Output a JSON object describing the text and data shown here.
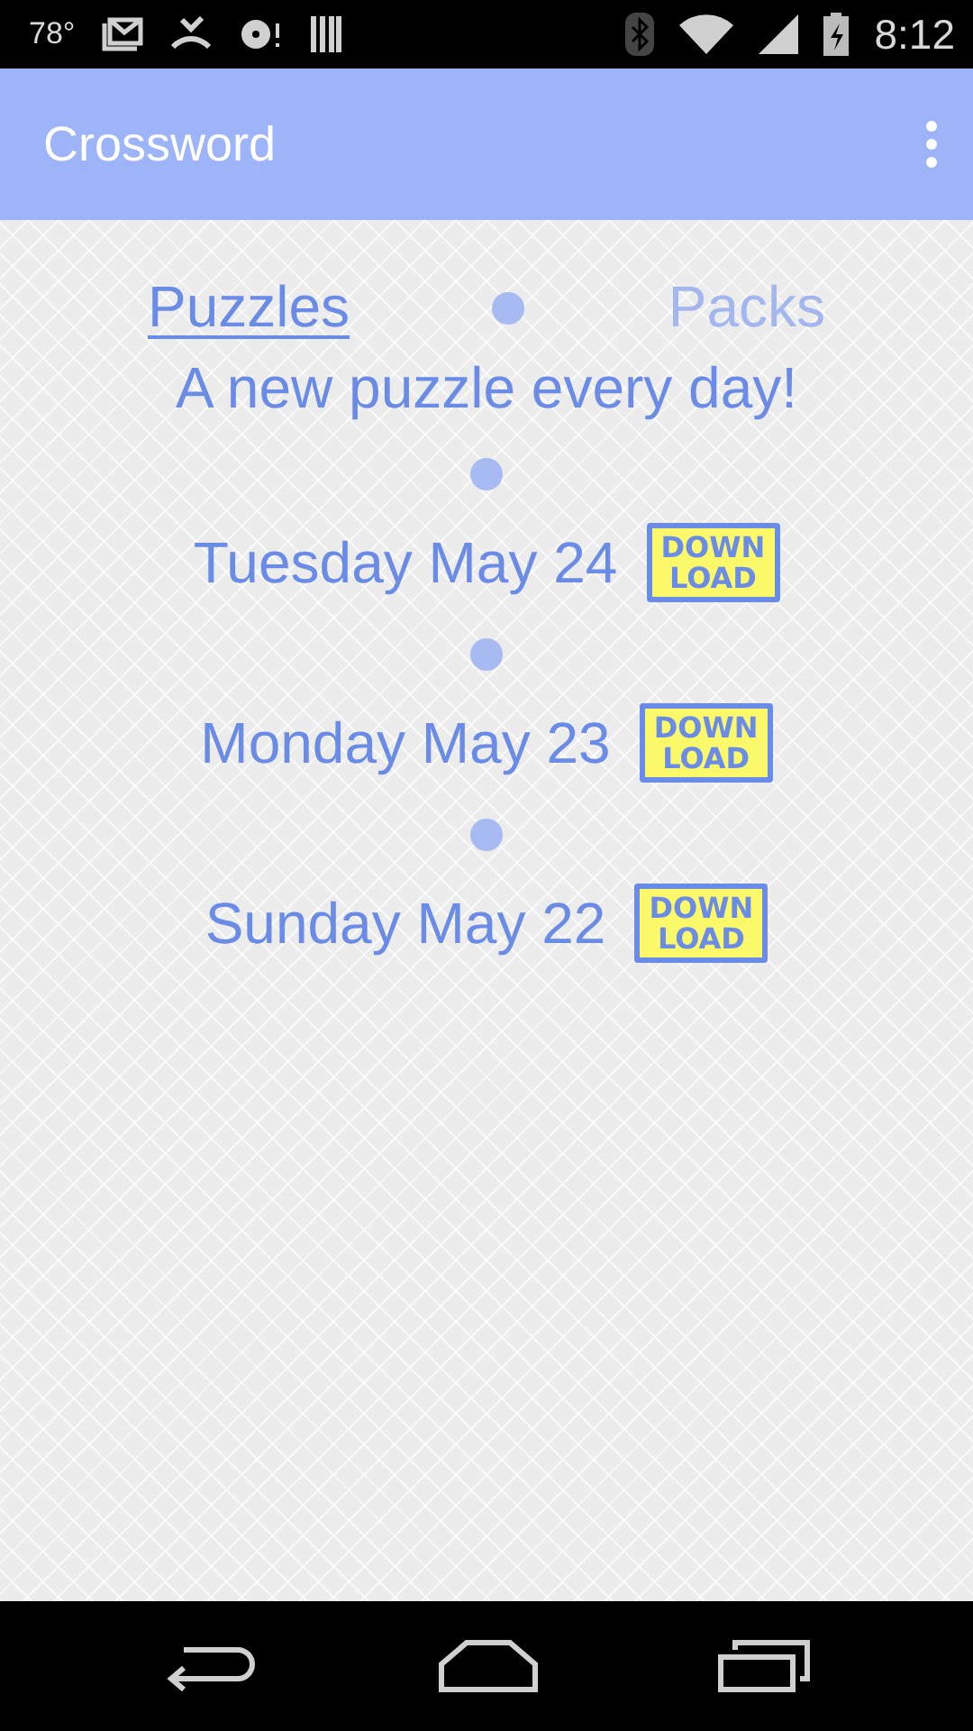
{
  "status_bar": {
    "temperature": "78°",
    "time": "8:12"
  },
  "app_bar": {
    "title": "Crossword"
  },
  "tabs": [
    {
      "label": "Puzzles",
      "selected": true
    },
    {
      "label": "Packs",
      "selected": false
    }
  ],
  "tagline": "A new puzzle every day!",
  "puzzles": [
    {
      "date": "Tuesday May 24",
      "action": "DOWN LOAD"
    },
    {
      "date": "Monday May 23",
      "action": "DOWN LOAD"
    },
    {
      "date": "Sunday May 22",
      "action": "DOWN LOAD"
    }
  ]
}
